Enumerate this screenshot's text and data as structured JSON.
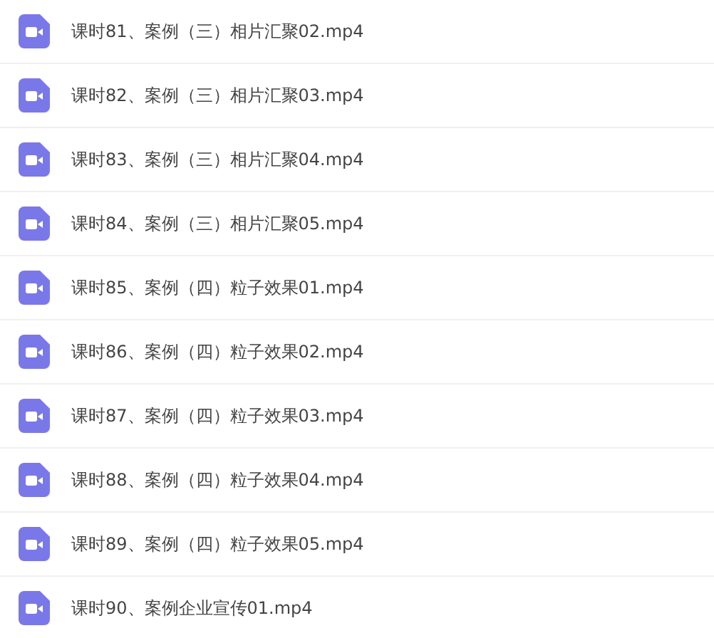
{
  "files": [
    {
      "name": "课时81、案例（三）相片汇聚02.mp4"
    },
    {
      "name": "课时82、案例（三）相片汇聚03.mp4"
    },
    {
      "name": "课时83、案例（三）相片汇聚04.mp4"
    },
    {
      "name": "课时84、案例（三）相片汇聚05.mp4"
    },
    {
      "name": "课时85、案例（四）粒子效果01.mp4"
    },
    {
      "name": "课时86、案例（四）粒子效果02.mp4"
    },
    {
      "name": "课时87、案例（四）粒子效果03.mp4"
    },
    {
      "name": "课时88、案例（四）粒子效果04.mp4"
    },
    {
      "name": "课时89、案例（四）粒子效果05.mp4"
    },
    {
      "name": "课时90、案例企业宣传01.mp4"
    }
  ]
}
